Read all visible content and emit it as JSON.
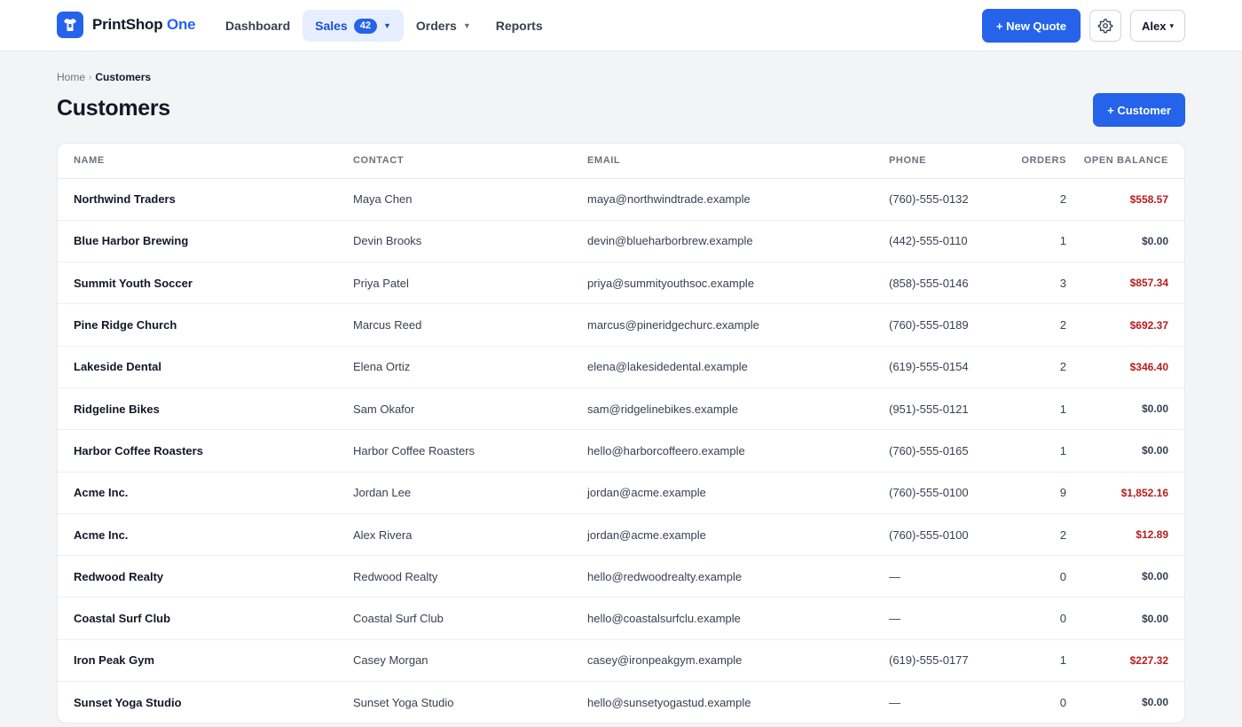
{
  "app": {
    "brand_primary": "PrintShop",
    "brand_accent": "One",
    "accent_color": "#2563eb",
    "balance_due_color": "#b91c1c"
  },
  "nav": {
    "dashboard": "Dashboard",
    "sales": "Sales",
    "sales_badge": "42",
    "orders": "Orders",
    "reports": "Reports"
  },
  "top_actions": {
    "new_quote": "+ New Quote",
    "settings_icon": "gear-icon",
    "user": "Alex"
  },
  "breadcrumb": {
    "home": "Home",
    "current": "Customers"
  },
  "page": {
    "title": "Customers",
    "add_customer": "+ Customer"
  },
  "table": {
    "columns": {
      "name": "Name",
      "contact": "Contact",
      "email": "Email",
      "phone": "Phone",
      "orders": "Orders",
      "balance": "Open Balance"
    },
    "rows": [
      {
        "name": "Northwind Traders",
        "contact": "Maya Chen",
        "email": "maya@northwindtrade.example",
        "phone": "(760)-555-0132",
        "orders": "2",
        "balance": "$558.57",
        "due": true
      },
      {
        "name": "Blue Harbor Brewing",
        "contact": "Devin Brooks",
        "email": "devin@blueharborbrew.example",
        "phone": "(442)-555-0110",
        "orders": "1",
        "balance": "$0.00",
        "due": false
      },
      {
        "name": "Summit Youth Soccer",
        "contact": "Priya Patel",
        "email": "priya@summityouthsoc.example",
        "phone": "(858)-555-0146",
        "orders": "3",
        "balance": "$857.34",
        "due": true
      },
      {
        "name": "Pine Ridge Church",
        "contact": "Marcus Reed",
        "email": "marcus@pineridgechurc.example",
        "phone": "(760)-555-0189",
        "orders": "2",
        "balance": "$692.37",
        "due": true
      },
      {
        "name": "Lakeside Dental",
        "contact": "Elena Ortiz",
        "email": "elena@lakesidedental.example",
        "phone": "(619)-555-0154",
        "orders": "2",
        "balance": "$346.40",
        "due": true
      },
      {
        "name": "Ridgeline Bikes",
        "contact": "Sam Okafor",
        "email": "sam@ridgelinebikes.example",
        "phone": "(951)-555-0121",
        "orders": "1",
        "balance": "$0.00",
        "due": false
      },
      {
        "name": "Harbor Coffee Roasters",
        "contact": "Harbor Coffee Roasters",
        "email": "hello@harborcoffeero.example",
        "phone": "(760)-555-0165",
        "orders": "1",
        "balance": "$0.00",
        "due": false
      },
      {
        "name": "Acme Inc.",
        "contact": "Jordan Lee",
        "email": "jordan@acme.example",
        "phone": "(760)-555-0100",
        "orders": "9",
        "balance": "$1,852.16",
        "due": true
      },
      {
        "name": "Acme Inc.",
        "contact": "Alex Rivera",
        "email": "jordan@acme.example",
        "phone": "(760)-555-0100",
        "orders": "2",
        "balance": "$12.89",
        "due": true
      },
      {
        "name": "Redwood Realty",
        "contact": "Redwood Realty",
        "email": "hello@redwoodrealty.example",
        "phone": "—",
        "orders": "0",
        "balance": "$0.00",
        "due": false
      },
      {
        "name": "Coastal Surf Club",
        "contact": "Coastal Surf Club",
        "email": "hello@coastalsurfclu.example",
        "phone": "—",
        "orders": "0",
        "balance": "$0.00",
        "due": false
      },
      {
        "name": "Iron Peak Gym",
        "contact": "Casey Morgan",
        "email": "casey@ironpeakgym.example",
        "phone": "(619)-555-0177",
        "orders": "1",
        "balance": "$227.32",
        "due": true
      },
      {
        "name": "Sunset Yoga Studio",
        "contact": "Sunset Yoga Studio",
        "email": "hello@sunsetyogastud.example",
        "phone": "—",
        "orders": "0",
        "balance": "$0.00",
        "due": false
      }
    ]
  }
}
